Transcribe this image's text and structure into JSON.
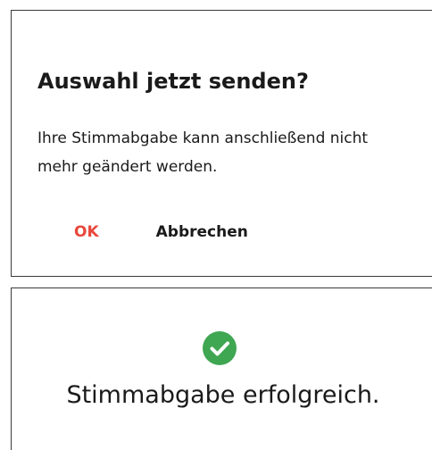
{
  "dialog": {
    "title": "Auswahl jetzt senden?",
    "message": "Ihre Stimmabgabe kann anschließend nicht mehr geändert werden.",
    "ok_label": "OK",
    "cancel_label": "Abbrechen"
  },
  "result": {
    "icon": "check-circle-icon",
    "message": "Stimmabgabe erfolgreich."
  },
  "colors": {
    "accent_red": "#e8473c",
    "success_green": "#3fa652",
    "text": "#1a1a1a",
    "border": "#3a3a3a"
  }
}
